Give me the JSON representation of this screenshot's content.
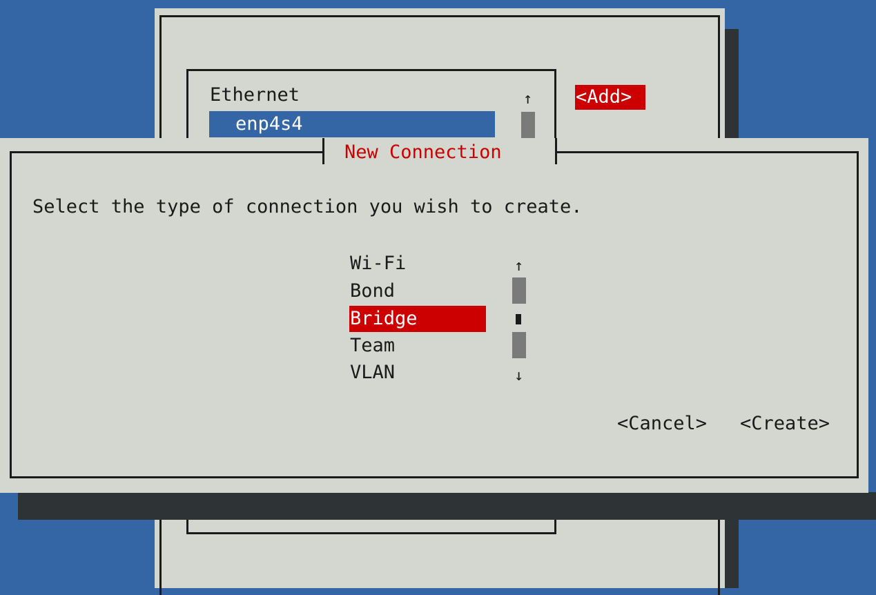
{
  "background_window": {
    "connections": {
      "group_label": "Ethernet",
      "selected_item": "enp4s4"
    },
    "add_button": "<Add>",
    "scroll_up": "↑"
  },
  "dialog": {
    "title": "New Connection",
    "prompt": "Select the type of connection you wish to create.",
    "types": [
      "Wi-Fi",
      "Bond",
      "Bridge",
      "Team",
      "VLAN"
    ],
    "selected_type": "Bridge",
    "scroll_up": "↑",
    "scroll_down": "↓",
    "cancel_button": "<Cancel>",
    "create_button": "<Create>"
  },
  "colors": {
    "desktop": "#3465a4",
    "panel": "#d3d7cf",
    "accent_red": "#cc0000",
    "selection_blue": "#3465a4",
    "shadow": "#2e3436"
  }
}
